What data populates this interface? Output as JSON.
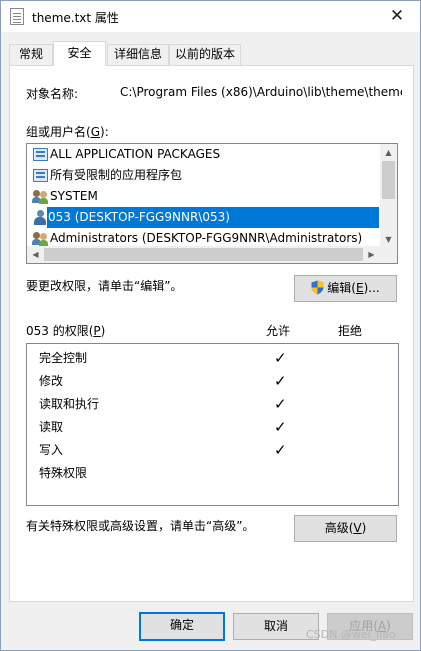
{
  "window": {
    "title": "theme.txt 属性",
    "close_glyph": "✕"
  },
  "tabs": [
    {
      "label": "常规",
      "active": false
    },
    {
      "label": "安全",
      "active": true
    },
    {
      "label": "详细信息",
      "active": false
    },
    {
      "label": "以前的版本",
      "active": false
    }
  ],
  "security": {
    "object_name_label": "对象名称:",
    "object_name_value": "C:\\Program Files (x86)\\Arduino\\lib\\theme\\theme",
    "group_label": "组或用户名",
    "group_label_key": "G",
    "principals": [
      {
        "name": "ALL APPLICATION PACKAGES",
        "icon": "package-icon",
        "selected": false
      },
      {
        "name": "所有受限制的应用程序包",
        "icon": "package-icon",
        "selected": false
      },
      {
        "name": "SYSTEM",
        "icon": "users-icon",
        "selected": false
      },
      {
        "name": "053 (DESKTOP-FGG9NNR\\053)",
        "icon": "user-icon",
        "selected": true
      },
      {
        "name": "Administrators (DESKTOP-FGG9NNR\\Administrators)",
        "icon": "users-icon",
        "selected": false
      }
    ],
    "edit_hint": "要更改权限，请单击“编辑”。",
    "edit_button": "编辑",
    "edit_button_key": "E",
    "permissions_label": "053 的权限",
    "permissions_label_key": "P",
    "allow_header": "允许",
    "deny_header": "拒绝",
    "permissions": [
      {
        "name": "完全控制",
        "allow": true,
        "deny": false
      },
      {
        "name": "修改",
        "allow": true,
        "deny": false
      },
      {
        "name": "读取和执行",
        "allow": true,
        "deny": false
      },
      {
        "name": "读取",
        "allow": true,
        "deny": false
      },
      {
        "name": "写入",
        "allow": true,
        "deny": false
      },
      {
        "name": "特殊权限",
        "allow": false,
        "deny": false
      }
    ],
    "check_glyph": "✓",
    "advanced_hint": "有关特殊权限或高级设置，请单击“高级”。",
    "advanced_button": "高级",
    "advanced_button_key": "V"
  },
  "footer": {
    "ok": "确定",
    "cancel": "取消",
    "apply": "应用",
    "apply_key": "A"
  },
  "watermark": "CSDN @wei_liao",
  "colors": {
    "selection": "#0078d7",
    "default_border": "#0078d7"
  }
}
